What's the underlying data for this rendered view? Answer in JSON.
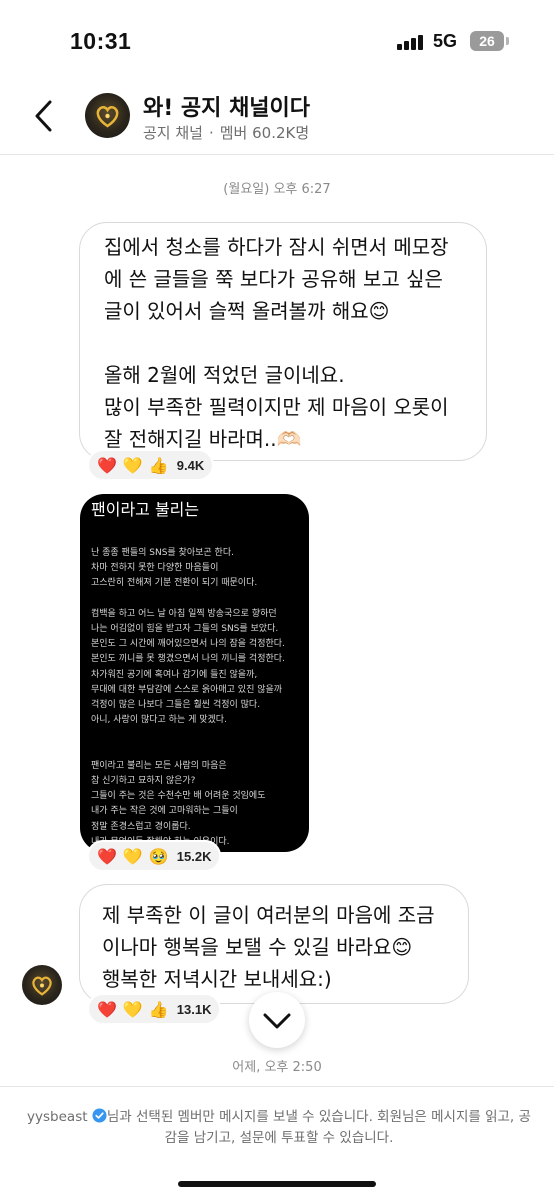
{
  "status_bar": {
    "time": "10:31",
    "network": "5G",
    "battery": "26"
  },
  "header": {
    "title": "와! 공지 채널이다",
    "channel_type": "공지 채널",
    "separator": "·",
    "members": "멤버 60.2K명"
  },
  "chat": {
    "day_stamp": "(월요일) 오후 6:27",
    "message1": {
      "text": "집에서 청소를 하다가 잠시 쉬면서 메모장에 쓴 글들을 쭉 보다가 공유해 보고 싶은 글이 있어서 슬쩍 올려볼까 해요😊\n\n올해 2월에 적었던 글이네요.\n많이 부족한 필력이지만 제 마음이 오롯이 잘 전해지길 바라며..🫶🏻",
      "reactions": [
        "❤️",
        "💛",
        "👍"
      ],
      "count": "9.4K"
    },
    "image_post": {
      "title": "팬이라고 불리는",
      "body": "난 종종 팬들의 SNS를 찾아보곤 한다.\n차마 전하지 못한 다양한 마음들이\n고스란히 전해져 기분 전환이 되기 때문이다.\n\n컴백을 하고 어느 날 아침 일찍 방송국으로 향하던\n나는 어김없이 힘을 받고자 그들의 SNS를 보았다.\n본인도 그 시간에 깨어있으면서 나의 잠을 걱정한다.\n본인도 끼니를 못 챙겼으면서 나의 끼니를 걱정한다.\n차가워진 공기에 혹여나 감기에 들진 않을까,\n무대에 대한 부담감에 스스로 옭아매고 있진 않을까\n걱정이 많은 나보다 그들은 훨씬 걱정이 많다.\n아니, 사랑이 많다고 하는 게 맞겠다.\n\n\n팬이라고 불리는 모든 사람의 마음은\n참 신기하고 묘하지 않은가?\n그들이 주는 것은 수천수만 배 어려운 것임에도\n내가 주는 작은 것에 고마워하는 그들이\n정말 존경스럽고 경이롭다.\n내가 무엇이든 잘해야 하는 이유이다.",
      "reactions": [
        "❤️",
        "💛",
        "🥹"
      ],
      "count": "15.2K"
    },
    "message3": {
      "text": "제 부족한 이 글이 여러분의 마음에 조금이나마 행복을 보탤 수 있길 바라요😊\n행복한 저녁시간 보내세요:)",
      "reactions": [
        "❤️",
        "💛",
        "👍"
      ],
      "count": "13.1K"
    },
    "message_time": "어제, 오후 2:50"
  },
  "footer": {
    "username": "yysbeast",
    "notice": "님과 선택된 멤버만 메시지를 보낼 수 있습니다. 회원님은 메시지를 읽고, 공감을 남기고, 설문에 투표할 수 있습니다."
  },
  "icons": {
    "back": "chevron-left-icon",
    "scroll_down": "chevron-down-icon",
    "verified": "verified-badge-icon",
    "avatar_logo": "heart-logo-icon"
  },
  "colors": {
    "verified_blue": "#3797f0",
    "avatar_heart": "#e8b339"
  }
}
